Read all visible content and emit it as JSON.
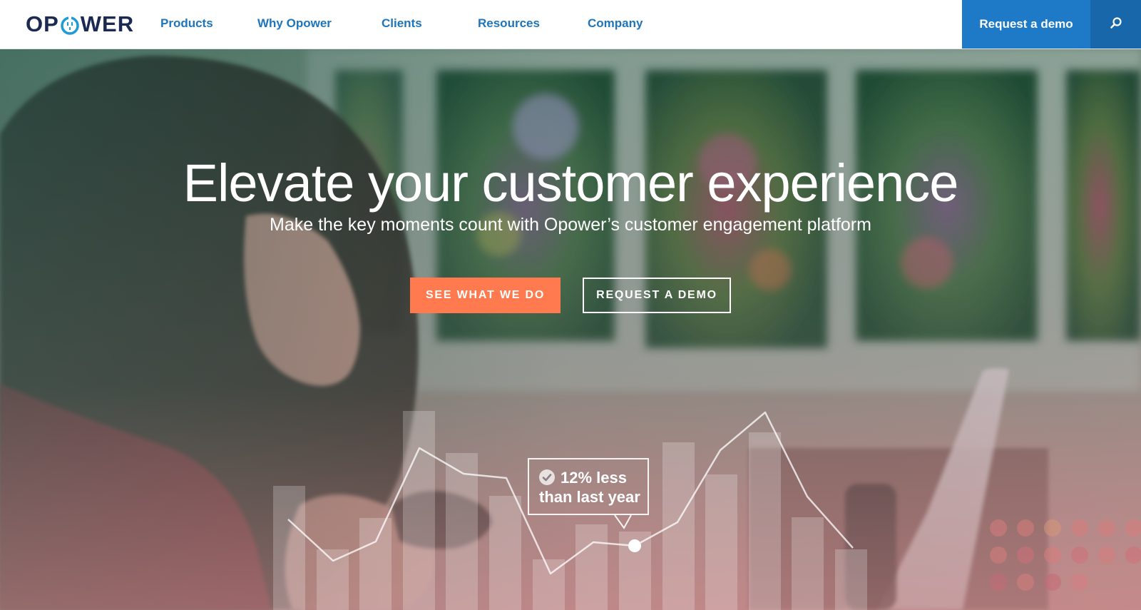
{
  "brand": {
    "name_left": "OP",
    "name_right": "WER",
    "colors": {
      "navy": "#1b2a52",
      "blue": "#1e75bb",
      "cta_orange": "#ff7a4e"
    }
  },
  "nav": {
    "items": [
      {
        "label": "Products"
      },
      {
        "label": "Why Opower"
      },
      {
        "label": "Clients"
      },
      {
        "label": "Resources"
      },
      {
        "label": "Company"
      }
    ],
    "request_demo": "Request a demo",
    "search_icon": "search-icon"
  },
  "hero": {
    "title": "Elevate your customer experience",
    "subtitle": "Make the key moments count with Opower’s customer engagement platform",
    "primary_cta": "SEE WHAT WE DO",
    "secondary_cta": "REQUEST A DEMO",
    "callout_line1": "12% less",
    "callout_line2": "than last year"
  }
}
